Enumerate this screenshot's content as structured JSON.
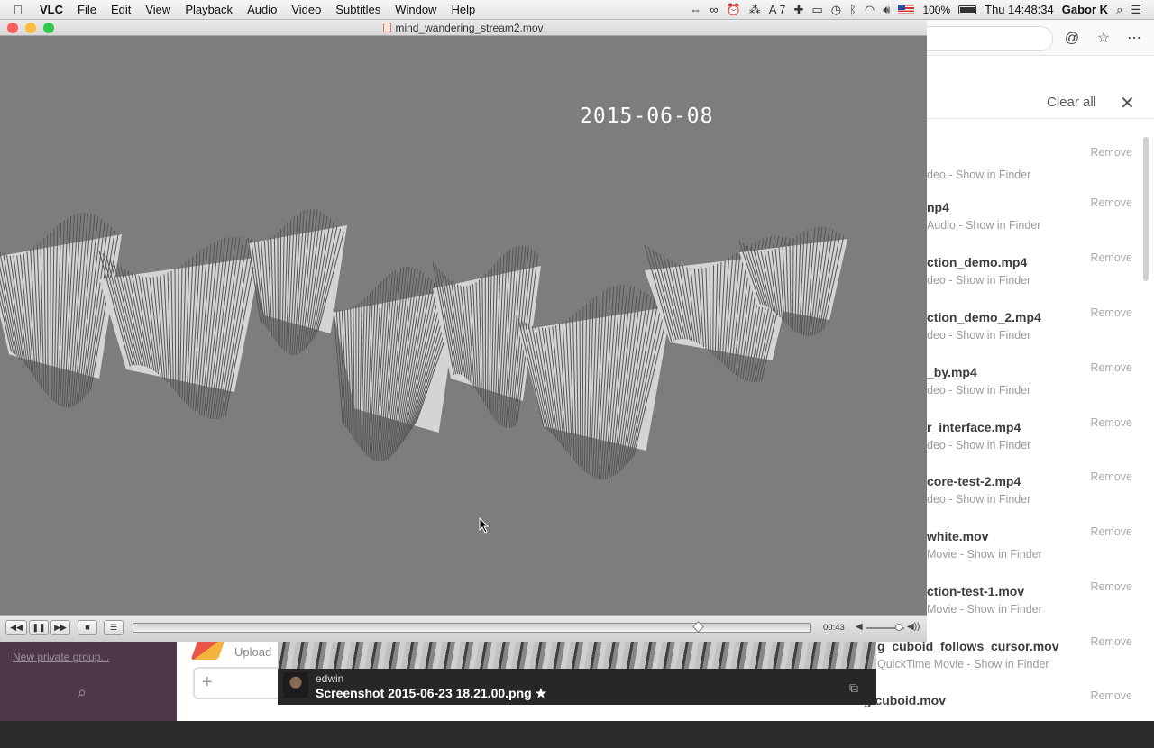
{
  "menubar": {
    "app_name": "VLC",
    "menus": [
      "File",
      "Edit",
      "View",
      "Playback",
      "Audio",
      "Video",
      "Subtitles",
      "Window",
      "Help"
    ],
    "status": {
      "adobe_count": "7",
      "battery": "100%",
      "clock": "Thu 14:48:34",
      "user": "Gabor K"
    }
  },
  "vlc": {
    "title": "mind_wandering_stream2.mov",
    "overlay_date": "2015-06-08",
    "time": "00:43",
    "seek_fraction": 0.84,
    "volume_fraction": 0.95,
    "colors": {
      "close": "#fc605c",
      "minimize": "#fdbc40",
      "zoom": "#34c84a",
      "video_bg": "#7d7d7d"
    }
  },
  "slack": {
    "panel": {
      "clear_all": "Clear all"
    },
    "files": [
      {
        "title": "",
        "meta": "deo - Show in Finder",
        "remove": "Remove"
      },
      {
        "title": "np4",
        "meta": "Audio - Show in Finder",
        "remove": "Remove"
      },
      {
        "title": "ction_demo.mp4",
        "meta": "deo - Show in Finder",
        "remove": "Remove"
      },
      {
        "title": "ction_demo_2.mp4",
        "meta": "deo - Show in Finder",
        "remove": "Remove"
      },
      {
        "title": "_by.mp4",
        "meta": "deo - Show in Finder",
        "remove": "Remove"
      },
      {
        "title": "r_interface.mp4",
        "meta": "deo - Show in Finder",
        "remove": "Remove"
      },
      {
        "title": "core-test-2.mp4",
        "meta": "deo - Show in Finder",
        "remove": "Remove"
      },
      {
        "title": "white.mov",
        "meta": "Movie - Show in Finder",
        "remove": "Remove"
      },
      {
        "title": "ction-test-1.mov",
        "meta": "Movie - Show in Finder",
        "remove": "Remove"
      },
      {
        "title": "g_cuboid_follows_cursor.mov",
        "meta": "QuickTime Movie - Show in Finder",
        "remove": "Remove"
      },
      {
        "title": "g cuboid.mov",
        "meta": "",
        "remove": "Remove"
      }
    ],
    "sidebar": {
      "new_private_group": "New private group..."
    },
    "upload_label": "Upload",
    "notification": {
      "user": "edwin",
      "file": "Screenshot 2015-06-23 18.21.00.png ★"
    }
  }
}
